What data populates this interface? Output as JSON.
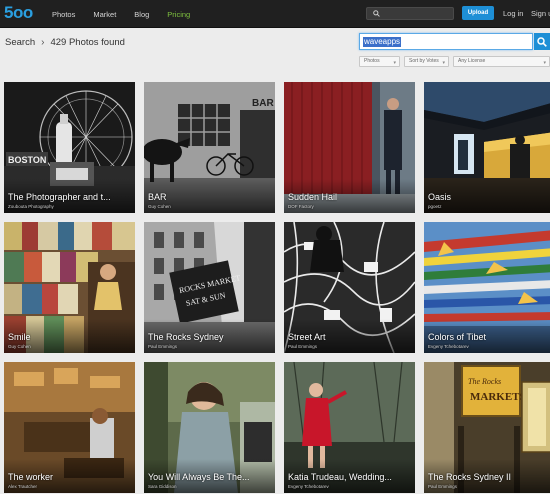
{
  "brand": {
    "logo_text": "5oo"
  },
  "nav": {
    "items": [
      "Photos",
      "Market",
      "Blog",
      "Pricing"
    ],
    "active": "Pricing"
  },
  "header": {
    "upload_label": "Upload",
    "login_label": "Log in",
    "signup_label": "Sign up"
  },
  "breadcrumb": {
    "root": "Search",
    "separator": "›",
    "result": "429 Photos found"
  },
  "search": {
    "value": "waveapps"
  },
  "filters": {
    "type": "Photos",
    "sort": "Sort by Votes",
    "license": "Any License"
  },
  "colors": {
    "accent": "#1e8fd6",
    "active_nav": "#7fc23f",
    "topbar": "#202020"
  },
  "photos": [
    {
      "title": "The Photographer and t...",
      "author": "Zoubouta Photography"
    },
    {
      "title": "BAR",
      "author": "Guy Cohen"
    },
    {
      "title": "Sudden Hail",
      "author": "DOF Factory"
    },
    {
      "title": "Oasis",
      "author": "pgoetz"
    },
    {
      "title": "Smile",
      "author": "Guy Cohen"
    },
    {
      "title": "The Rocks Sydney",
      "author": "Paul Emmings"
    },
    {
      "title": "Street Art",
      "author": "Paul Emmings"
    },
    {
      "title": "Colors of Tibet",
      "author": "Evgeny Tchebotarev"
    },
    {
      "title": "The worker",
      "author": "Alex Trautcher"
    },
    {
      "title": "You Will Always Be The...",
      "author": "Sara Giddison"
    },
    {
      "title": "Katia Trudeau, Wedding...",
      "author": "Evgeny Tchebotarev"
    },
    {
      "title": "The Rocks Sydney II",
      "author": "Paul Emmings"
    }
  ]
}
